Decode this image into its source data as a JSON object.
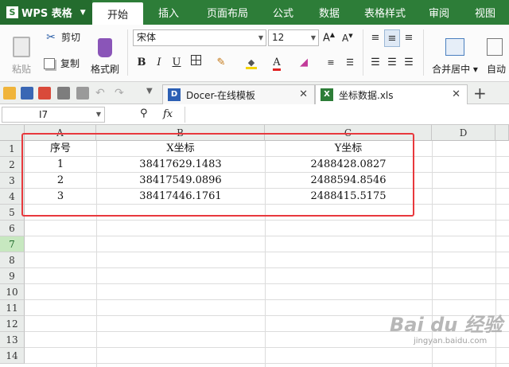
{
  "app": {
    "name": "WPS 表格"
  },
  "menu": {
    "tabs": [
      "开始",
      "插入",
      "页面布局",
      "公式",
      "数据",
      "表格样式",
      "审阅",
      "视图"
    ],
    "active": "开始"
  },
  "ribbon": {
    "paste": "粘贴",
    "cut": "剪切",
    "copy": "复制",
    "format_painter": "格式刷",
    "font_name": "宋体",
    "font_size": "12",
    "bold": "B",
    "italic": "I",
    "underline": "U",
    "merge_center": "合并居中",
    "auto": "自动"
  },
  "doc_tabs": [
    {
      "label": "Docer-在线模板",
      "icon": "docer-icon"
    },
    {
      "label": "坐标数据.xls",
      "icon": "excel-file-icon"
    }
  ],
  "formula_bar": {
    "cell_ref": "I7",
    "fx": "fx",
    "value": ""
  },
  "sheet": {
    "columns": [
      "A",
      "B",
      "C",
      "D"
    ],
    "rows": [
      "1",
      "2",
      "3",
      "4",
      "5",
      "6",
      "7",
      "8",
      "9",
      "10",
      "11",
      "12",
      "13",
      "14"
    ],
    "selected_row": "7",
    "cells": [
      [
        "序号",
        "X坐标",
        "Y坐标"
      ],
      [
        "1",
        "38417629.1483",
        "2488428.0827"
      ],
      [
        "2",
        "38417549.0896",
        "2488594.8546"
      ],
      [
        "3",
        "38417446.1761",
        "2488415.5175"
      ]
    ]
  },
  "watermark": {
    "main": "Bai du 经验",
    "sub": "jingyan.baidu.com"
  },
  "colors": {
    "menubar": "#2d7d38",
    "highlight_box": "#e8383d",
    "selected_row": "#c7e8c0"
  }
}
